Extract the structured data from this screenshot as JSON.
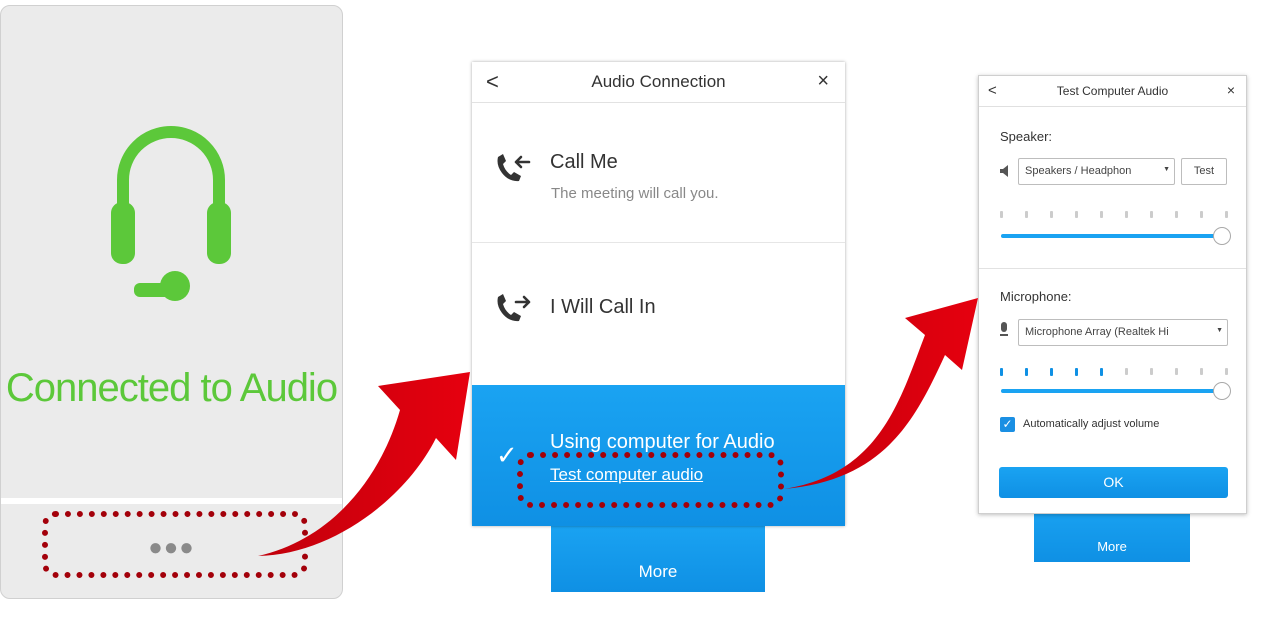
{
  "panel_connected": {
    "title": "Connected to Audio",
    "more_dots": "●●●",
    "icon": "headset-icon",
    "accent": "#5cc83a"
  },
  "audio_connection": {
    "back": "<",
    "title": "Audio Connection",
    "close": "×",
    "options": [
      {
        "label": "Call Me",
        "sublabel": "The meeting will call you.",
        "icon": "phone-incoming-icon"
      },
      {
        "label": "I Will Call In",
        "icon": "phone-outgoing-icon"
      }
    ],
    "selected": {
      "check": "✓",
      "label": "Using computer for Audio",
      "link": "Test computer audio"
    },
    "more_tab": "More"
  },
  "test_audio": {
    "back": "<",
    "title": "Test Computer Audio",
    "close": "×",
    "speaker_label": "Speaker:",
    "speaker_device": "Speakers / Headphon",
    "test_button": "Test",
    "speaker_volume": 1.0,
    "mic_label": "Microphone:",
    "mic_device": "Microphone Array (Realtek Hi",
    "mic_level_active_ticks": 5,
    "mic_volume": 1.0,
    "auto_adjust_label": "Automatically adjust volume",
    "auto_adjust_checked": true,
    "ok_button": "OK",
    "more_tab": "More"
  },
  "colors": {
    "accent_blue": "#1aa3f2",
    "highlight_red": "#a3000a"
  }
}
